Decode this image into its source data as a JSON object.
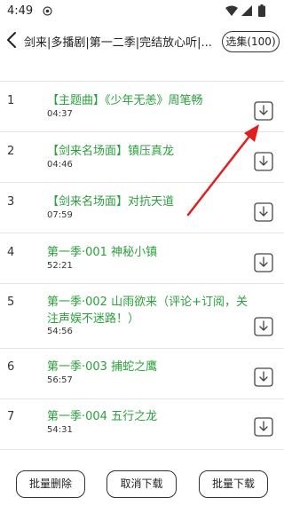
{
  "status_bar": {
    "time": "4:49"
  },
  "header": {
    "title": "剑来|多播剧|第一二季|完结放心听|...",
    "select_label": "选集(100)"
  },
  "episodes": [
    {
      "index": "1",
      "title": "【主题曲】《少年无恙》周笔畅",
      "duration": "04:37"
    },
    {
      "index": "2",
      "title": "【剑来名场面】镇压真龙",
      "duration": "04:46"
    },
    {
      "index": "3",
      "title": "【剑来名场面】对抗天道",
      "duration": "07:59"
    },
    {
      "index": "4",
      "title": "第一季·001 神秘小镇",
      "duration": "52:21"
    },
    {
      "index": "5",
      "title": "第一季·002 山雨欲来（评论+订阅，关注声娱不迷路！）",
      "duration": "54:56"
    },
    {
      "index": "6",
      "title": "第一季·003 捕蛇之鹰",
      "duration": "56:57"
    },
    {
      "index": "7",
      "title": "第一季·004 五行之龙",
      "duration": "54:31"
    }
  ],
  "footer": {
    "batch_delete": "批量删除",
    "cancel_download": "取消下载",
    "batch_download": "批量下载"
  },
  "colors": {
    "title_green": "#2ba03c",
    "annotation_red": "#e02020"
  },
  "icons": {
    "download": "download-icon",
    "back": "chevron-left-icon"
  }
}
